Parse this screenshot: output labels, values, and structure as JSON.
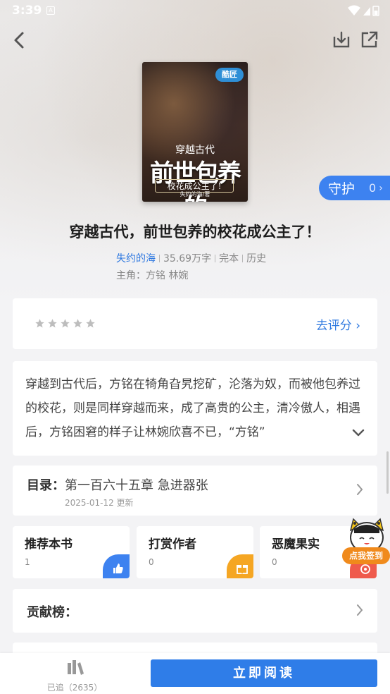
{
  "status_bar": {
    "time": "3:39",
    "notif_letter": "A"
  },
  "book": {
    "title": "穿越古代，前世包养的校花成公主了！",
    "author": "失约的海",
    "word_count": "35.69万字",
    "status": "完本",
    "genre": "历史",
    "protagonists": "主角：方铭 林婉",
    "cover": {
      "badge": "酷匠",
      "subtitle": "穿越古代",
      "title_main": "前世包养的",
      "title_second": "校花成公主了!",
      "author_line": "失约的海/著"
    }
  },
  "guard": {
    "label": "守护",
    "count": "0"
  },
  "rating": {
    "stars": 5,
    "action_label": "去评分"
  },
  "description": {
    "text": "穿越到古代后，方铭在犄角旮旯挖矿，沦落为奴，而被他包养过的校花，则是同样穿越而来，成了高贵的公主，清冷傲人，相遇后，方铭困窘的样子让林婉欣喜不已，“方铭”"
  },
  "toc": {
    "label": "目录：",
    "latest_chapter": "第一百六十五章 急进器张",
    "updated": "2025-01-12 更新"
  },
  "tiles": [
    {
      "title": "推荐本书",
      "count": "1",
      "color": "#3d82f0",
      "icon": "thumbs-up-icon"
    },
    {
      "title": "打赏作者",
      "count": "0",
      "color": "#f5a623",
      "icon": "gift-icon"
    },
    {
      "title": "恶魔果实",
      "count": "0",
      "color": "#ef5a4c",
      "icon": "fruit-icon"
    }
  ],
  "contrib": {
    "label": "贡献榜："
  },
  "checkin": {
    "label": "点我签到"
  },
  "bottom_bar": {
    "shelf_label": "已追（2635）",
    "read_label": "立即阅读"
  },
  "colors": {
    "accent": "#2f7de8",
    "link": "#2f79e0"
  }
}
